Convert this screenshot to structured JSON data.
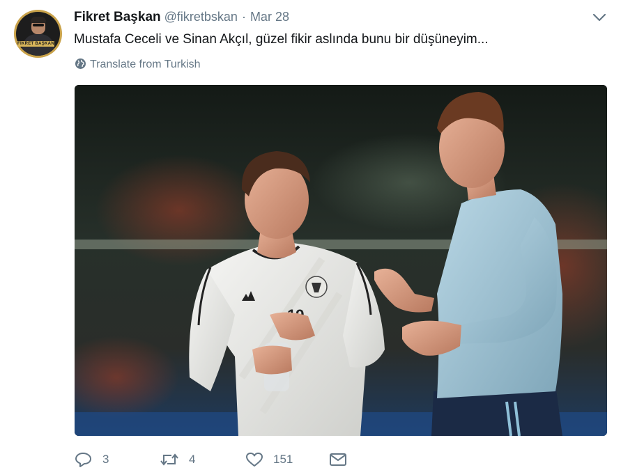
{
  "author": {
    "display_name": "Fikret Başkan",
    "handle": "@fikretbskan",
    "date": "Mar 28",
    "avatar_label": "FİKRET BAŞKAN"
  },
  "tweet": {
    "text": "Mustafa Ceceli ve Sinan Akçıl, güzel fikir aslında bunu bir düşüneyim...",
    "translate_label": "Translate from Turkish"
  },
  "media": {
    "shirt_number": "19"
  },
  "actions": {
    "reply_count": "3",
    "retweet_count": "4",
    "like_count": "151"
  },
  "icons": {
    "menu": "chevron-down-icon",
    "translate": "globe-icon",
    "reply": "reply-icon",
    "retweet": "retweet-icon",
    "like": "heart-icon",
    "dm": "envelope-icon"
  },
  "colors": {
    "text": "#14171a",
    "secondary": "#657786",
    "background": "#ffffff"
  }
}
